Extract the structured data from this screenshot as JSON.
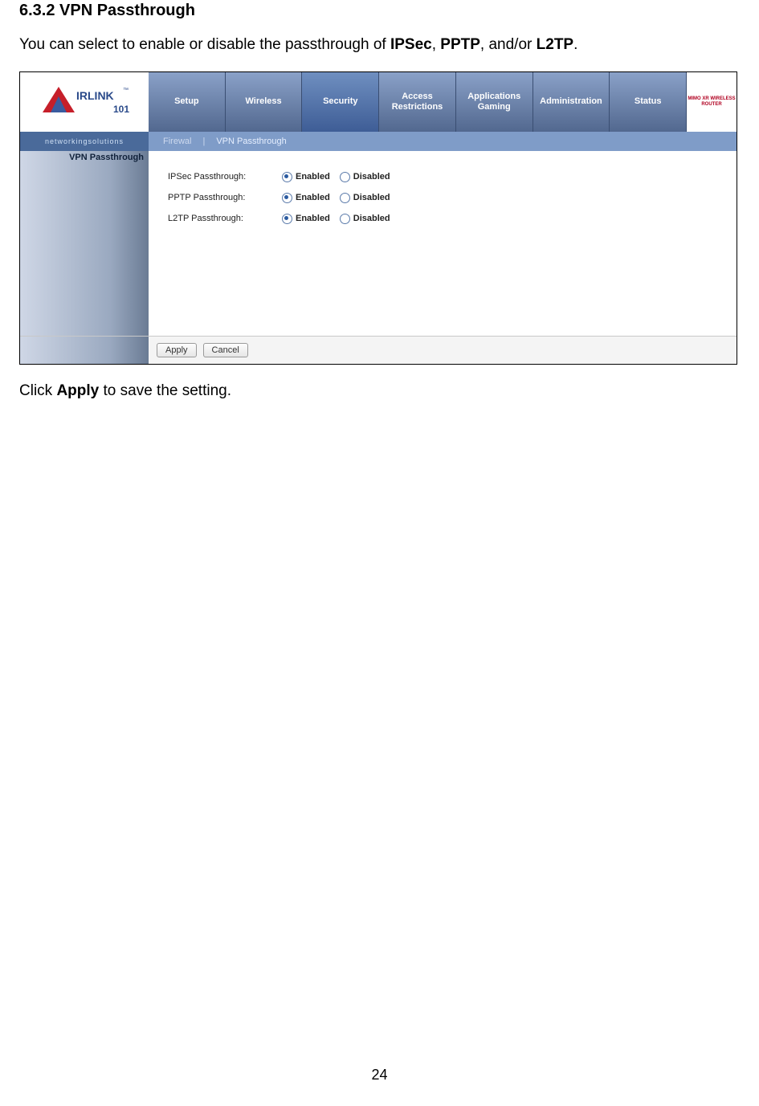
{
  "doc": {
    "heading": "6.3.2 VPN Passthrough",
    "intro_pre": "You can select to enable or disable the passthrough of ",
    "intro_b1": "IPSec",
    "intro_sep1": ", ",
    "intro_b2": "PPTP",
    "intro_sep2": ", and/or ",
    "intro_b3": "L2TP",
    "intro_end": ".",
    "outro_pre": "Click ",
    "outro_b": "Apply",
    "outro_post": " to save the setting.",
    "page_number": "24"
  },
  "router": {
    "brand_logo_text": "AIRLINK 101",
    "brand_tagline": "networkingsolutions",
    "badge": "MIMO XR WIRELESS ROUTER",
    "tabs": {
      "setup": "Setup",
      "wireless": "Wireless",
      "security": "Security",
      "access": "Access Restrictions",
      "apps": "Applications Gaming",
      "admin": "Administration",
      "status": "Status"
    },
    "subtabs": {
      "firewall": "Firewal",
      "vpn": "VPN Passthrough"
    },
    "section_label": "VPN Passthrough",
    "rows": {
      "ipsec": {
        "label": "IPSec Passthrough:",
        "enabled": "Enabled",
        "disabled": "Disabled"
      },
      "pptp": {
        "label": "PPTP Passthrough:",
        "enabled": "Enabled",
        "disabled": "Disabled"
      },
      "l2tp": {
        "label": "L2TP Passthrough:",
        "enabled": "Enabled",
        "disabled": "Disabled"
      }
    },
    "buttons": {
      "apply": "Apply",
      "cancel": "Cancel"
    }
  }
}
